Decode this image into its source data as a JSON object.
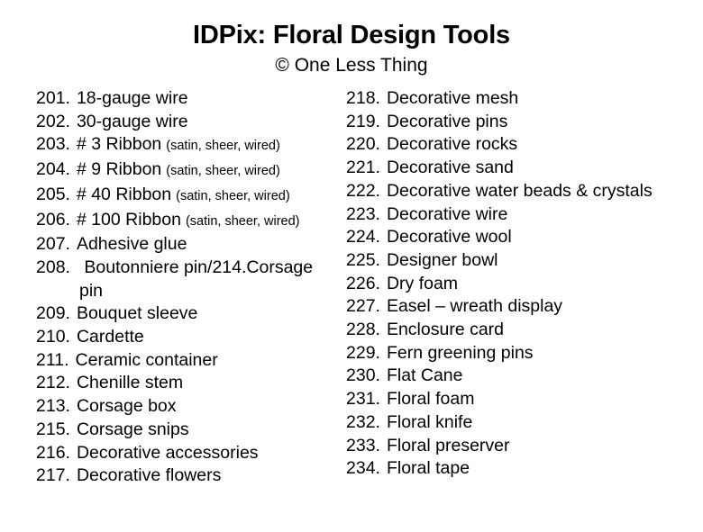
{
  "header": {
    "title": "IDPix: Floral Design Tools",
    "subtitle": "© One Less Thing"
  },
  "colors": {
    "background": "#ffffff",
    "text": "#000000"
  },
  "left_column": [
    {
      "num": "201.",
      "label": "18-gauge wire",
      "paren": ""
    },
    {
      "num": "202.",
      "label": "30-gauge wire",
      "paren": ""
    },
    {
      "num": "203.",
      "label": "# 3 Ribbon",
      "paren": "(satin, sheer, wired)"
    },
    {
      "num": "204.",
      "label": "# 9 Ribbon",
      "paren": "(satin, sheer, wired)"
    },
    {
      "num": "205.",
      "label": "# 40 Ribbon",
      "paren": "(satin, sheer, wired)"
    },
    {
      "num": "206.",
      "label": "# 100 Ribbon",
      "paren": "(satin, sheer, wired)"
    },
    {
      "num": "207.",
      "label": "Adhesive glue",
      "paren": ""
    },
    {
      "num": "208.",
      "label": "Boutonniere pin/214.Corsage pin",
      "paren": "",
      "wraps": true
    },
    {
      "num": "209.",
      "label": "Bouquet sleeve",
      "paren": ""
    },
    {
      "num": "210.",
      "label": "Cardette",
      "paren": ""
    },
    {
      "num": "211.",
      "label": "Ceramic container",
      "paren": ""
    },
    {
      "num": "212.",
      "label": "Chenille stem",
      "paren": ""
    },
    {
      "num": "213.",
      "label": "Corsage box",
      "paren": ""
    },
    {
      "num": "215.",
      "label": "Corsage snips",
      "paren": ""
    },
    {
      "num": "216.",
      "label": "Decorative accessories",
      "paren": ""
    },
    {
      "num": "217.",
      "label": "Decorative flowers",
      "paren": ""
    }
  ],
  "right_column": [
    {
      "num": "218.",
      "label": "Decorative mesh",
      "paren": ""
    },
    {
      "num": "219.",
      "label": "Decorative pins",
      "paren": ""
    },
    {
      "num": "220.",
      "label": "Decorative rocks",
      "paren": ""
    },
    {
      "num": "221.",
      "label": "Decorative sand",
      "paren": ""
    },
    {
      "num": "222.",
      "label": "Decorative water beads & crystals",
      "paren": ""
    },
    {
      "num": "223.",
      "label": "Decorative wire",
      "paren": ""
    },
    {
      "num": "224.",
      "label": "Decorative wool",
      "paren": ""
    },
    {
      "num": "225.",
      "label": "Designer bowl",
      "paren": ""
    },
    {
      "num": "226.",
      "label": "Dry foam",
      "paren": ""
    },
    {
      "num": "227.",
      "label": "Easel – wreath display",
      "paren": ""
    },
    {
      "num": "228.",
      "label": "Enclosure card",
      "paren": ""
    },
    {
      "num": "229.",
      "label": "Fern greening pins",
      "paren": ""
    },
    {
      "num": "230.",
      "label": "Flat Cane",
      "paren": ""
    },
    {
      "num": "231.",
      "label": "Floral foam",
      "paren": ""
    },
    {
      "num": "232.",
      "label": "Floral knife",
      "paren": ""
    },
    {
      "num": "233.",
      "label": "Floral preserver",
      "paren": ""
    },
    {
      "num": "234.",
      "label": "Floral tape",
      "paren": ""
    }
  ]
}
